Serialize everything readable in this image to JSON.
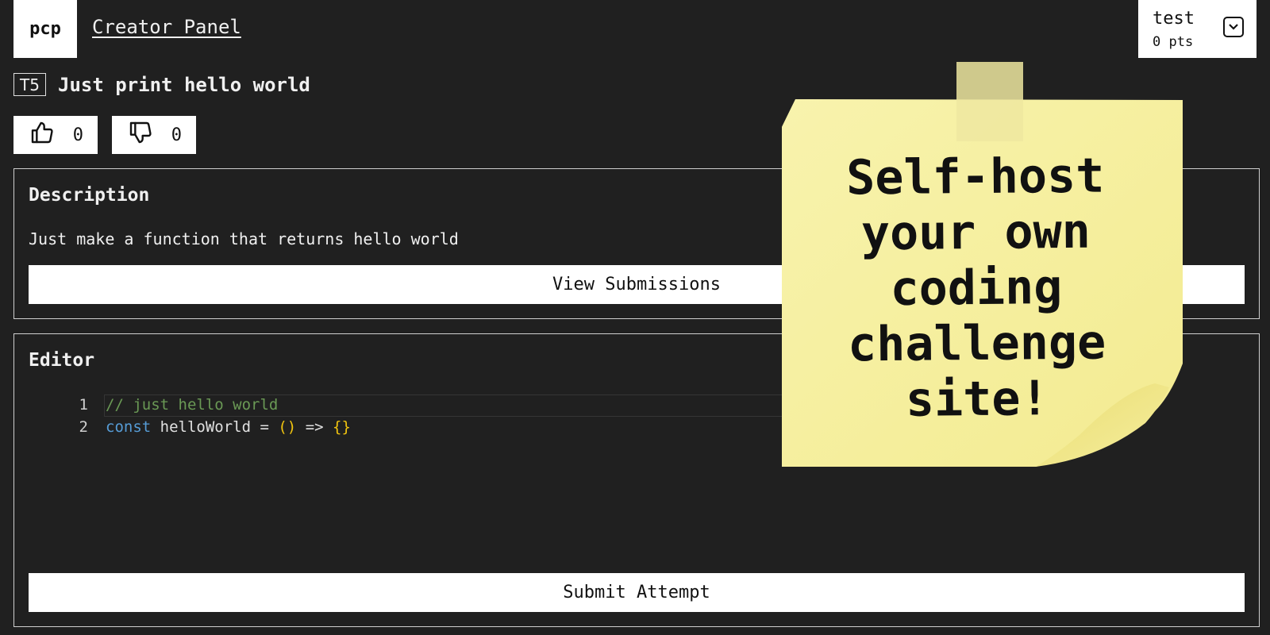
{
  "header": {
    "logo": "pcp",
    "creator_link": "Creator Panel",
    "user": {
      "name": "test",
      "points": "0 pts"
    }
  },
  "problem": {
    "tier": "T5",
    "title": "Just print hello world",
    "upvotes": "0",
    "downvotes": "0"
  },
  "description": {
    "heading": "Description",
    "text": "Just make a function that returns hello world",
    "view_submissions_label": "View Submissions"
  },
  "editor": {
    "heading": "Editor",
    "line_numbers": [
      "1",
      "2"
    ],
    "line1": "// just hello world",
    "line2": {
      "keyword": "const",
      "ident": " helloWorld = ",
      "parens": "()",
      "arrow": " => ",
      "braces": "{}"
    },
    "submit_label": "Submit Attempt"
  },
  "sticky_note": {
    "lines": [
      "Self-host",
      "your own",
      "coding",
      "challenge",
      "site!"
    ]
  },
  "colors": {
    "background": "#202020",
    "comment": "#6a9955",
    "keyword": "#569cd6",
    "bracket": "#f1c40f",
    "sticky": "#f7f1a2"
  }
}
